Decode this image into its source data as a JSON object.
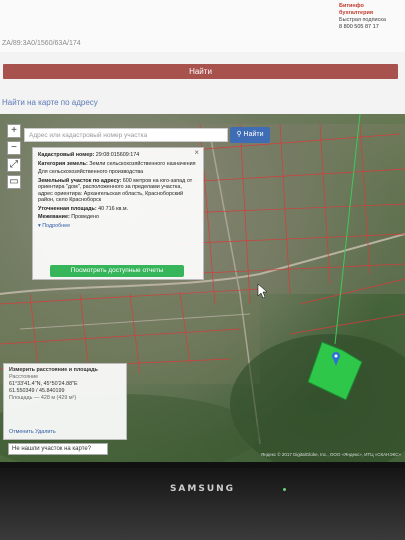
{
  "header": {
    "cadastral_url": "ZA/89:3A0/1560/63A/174",
    "ad": {
      "brand": "Битинфо бухгалтерия",
      "line1": "Быстрая подписка",
      "phone": "8 800 505 87 17"
    },
    "find_button_label": "Найти",
    "section_title": "Найти на карте по адресу"
  },
  "map": {
    "search_placeholder": "Адрес или кадастровый номер участка",
    "search_button_label": "Найти",
    "zoom_in": "+",
    "zoom_out": "−",
    "popup": {
      "cad_label": "Кадастровый номер:",
      "cad_value": "29:08:015609:174",
      "cat_label": "Категория земель:",
      "cat_value": "Земли сельскохозяйственного назначения",
      "use_value": "Для сельскохозяйственного производства",
      "addr_label": "Земельный участок по адресу:",
      "addr_value": "600 метров на юго-запад от ориентира \"дом\", расположенного за пределами участка, адрес ориентира: Архангельская область, Красноборский район, село Красноборск",
      "area_label": "Уточненная площадь:",
      "area_value": "40 716 кв.м.",
      "survey_label": "Межевание:",
      "survey_value": "Проведено",
      "more_label": "Подробнее",
      "action_label": "Посмотреть доступные отчеты"
    },
    "measure": {
      "title": "Измерить расстояние и площадь",
      "distance_label": "Расстояние",
      "coord1": "61°33'41.4\"N, 45°50'24.88\"E",
      "coord2": "61.550349 / 45.840199",
      "area_label": "Площадь — 428 м (429 м²)",
      "footer": "Отменить  Удалить"
    },
    "not_found_label": "Не нашли участок на карте?",
    "attribution": "Яндекс © 2017 DigitalGlobe, Inc., ООО «Яндекс», ИТЦ «СКАНЭКС»"
  },
  "monitor_brand": "SAMSUNG",
  "colors": {
    "find_button": "#a8524e",
    "section_title": "#5a7ab7",
    "map_button": "#3f6db5",
    "action_button": "#36b55a",
    "selected_plot": "#2ed14c",
    "parcel_lines": "#d63c3c"
  }
}
